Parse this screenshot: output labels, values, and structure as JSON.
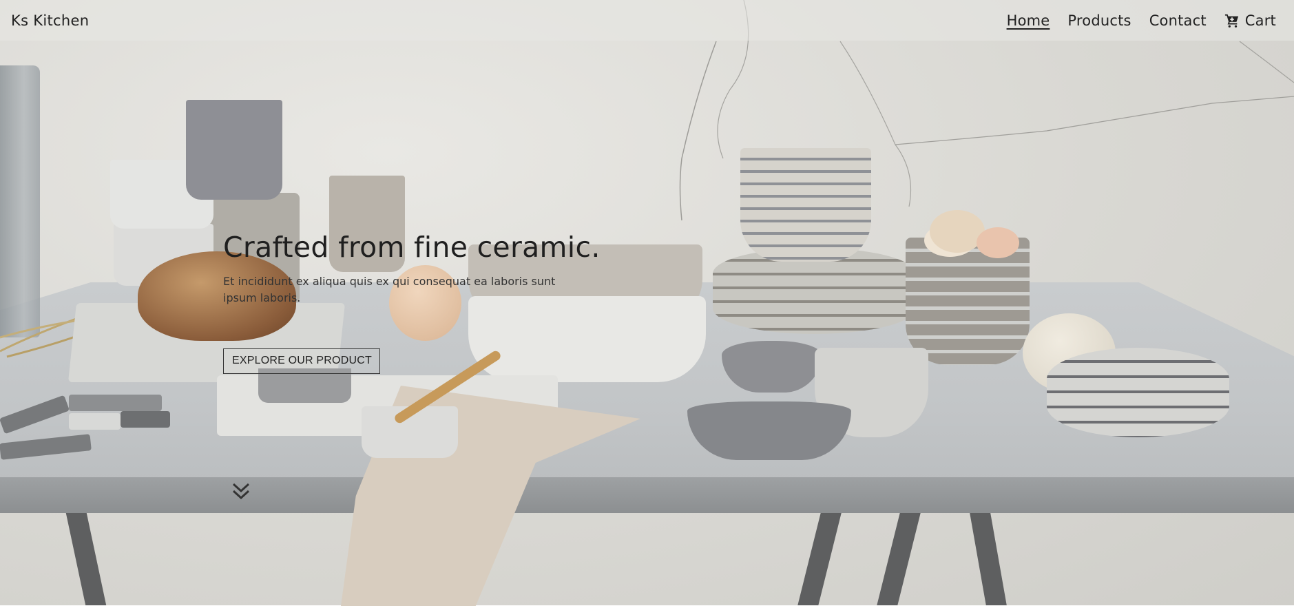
{
  "brand": "Ks Kitchen",
  "nav": {
    "home": "Home",
    "products": "Products",
    "contact": "Contact",
    "cart": "Cart"
  },
  "hero": {
    "title": "Crafted from fine ceramic.",
    "subtitle": "Et incididunt ex aliqua quis ex qui consequat ea laboris sunt ipsum laboris.",
    "cta": "EXPLORE OUR PRODUCT"
  },
  "icons": {
    "cart": "shopping-cart-icon",
    "scroll": "double-chevron-down-icon"
  },
  "colors": {
    "text": "#222222",
    "navbar_bg": "#e8e7e4",
    "table": "#c6c9cb"
  }
}
